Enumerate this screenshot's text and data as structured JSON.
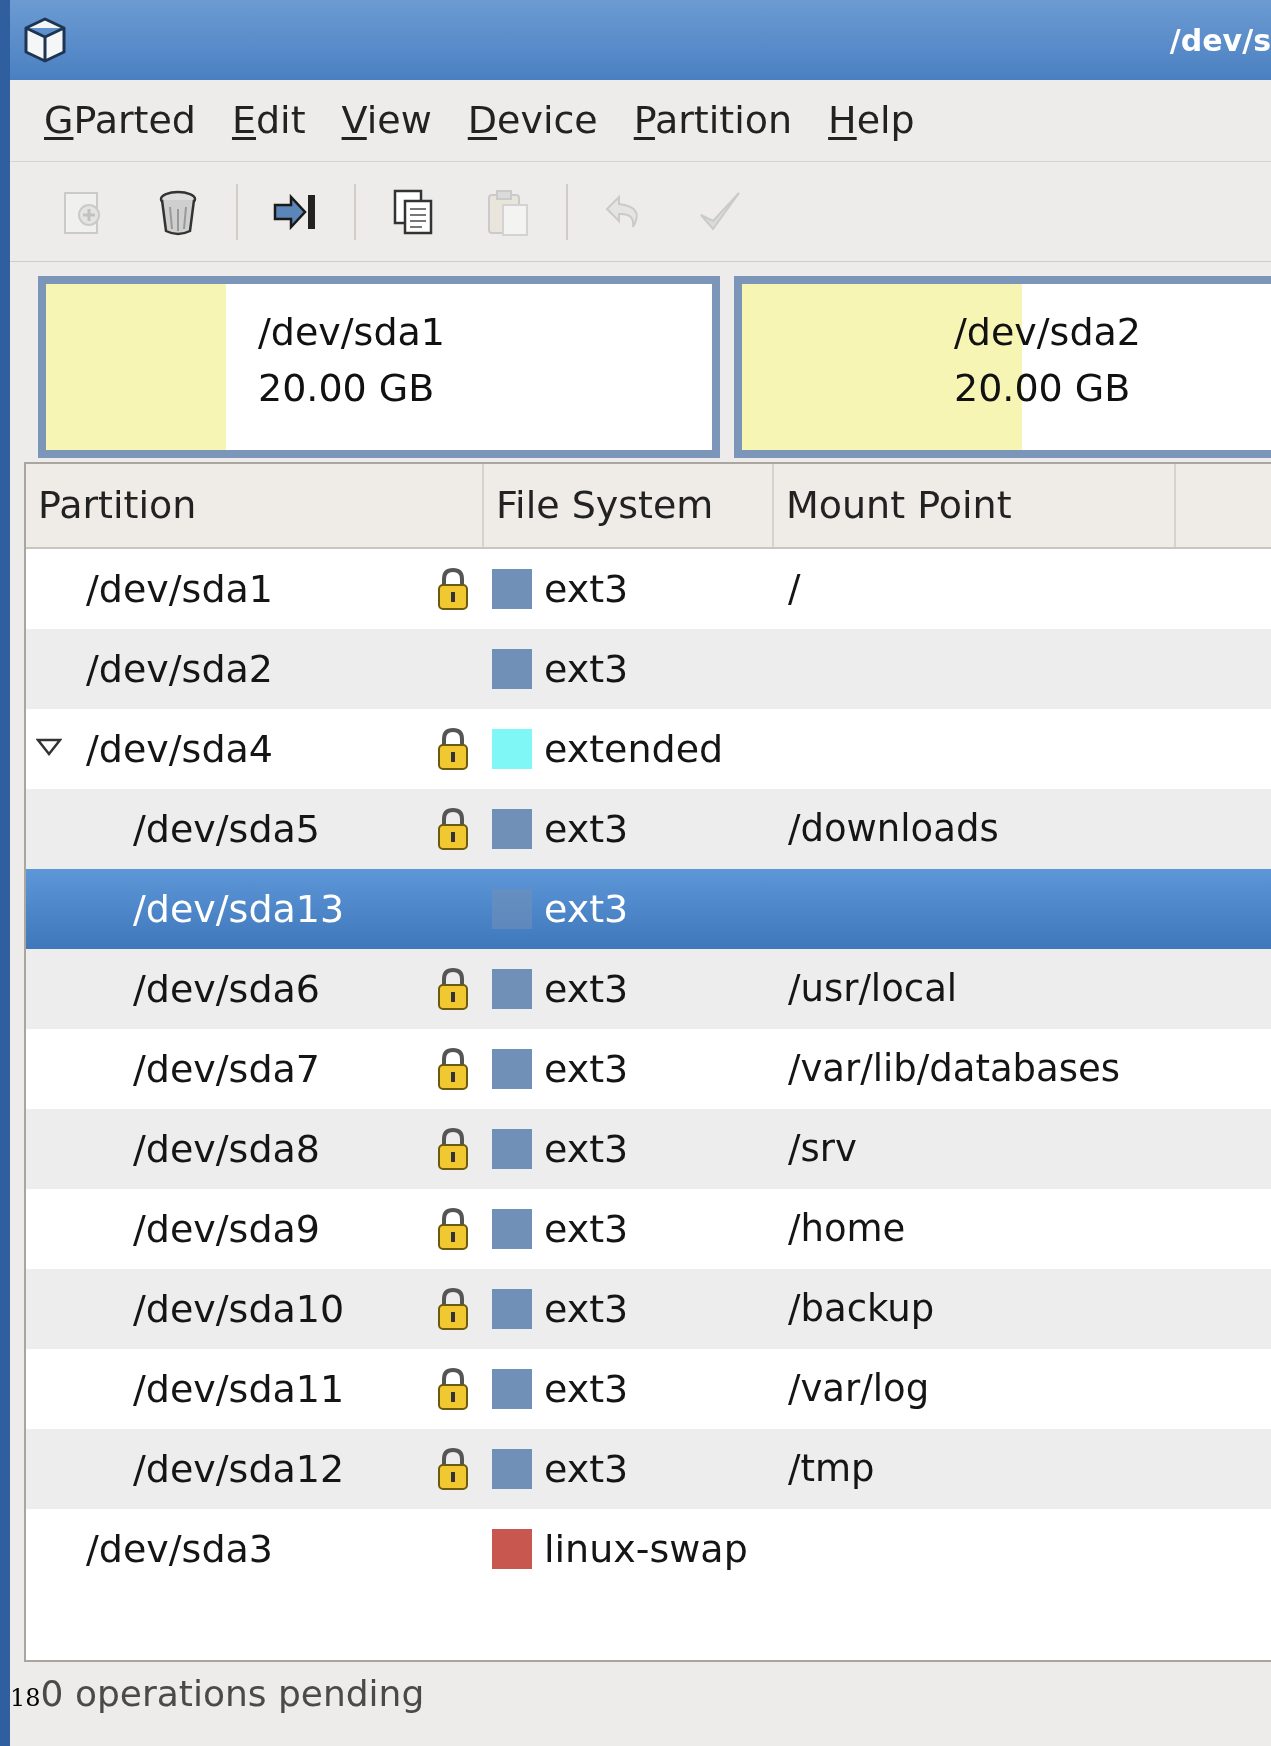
{
  "window": {
    "title": "/dev/s"
  },
  "menu": [
    "GParted",
    "Edit",
    "View",
    "Device",
    "Partition",
    "Help"
  ],
  "toolbar": [
    {
      "kind": "new",
      "disabled": true
    },
    {
      "kind": "delete",
      "disabled": false
    },
    {
      "kind": "separator"
    },
    {
      "kind": "resize",
      "disabled": false
    },
    {
      "kind": "separator"
    },
    {
      "kind": "copy",
      "disabled": false
    },
    {
      "kind": "paste",
      "disabled": true
    },
    {
      "kind": "separator"
    },
    {
      "kind": "undo",
      "disabled": true
    },
    {
      "kind": "apply",
      "disabled": true
    }
  ],
  "disk_graph": [
    {
      "name": "/dev/sda1",
      "size": "20.00 GB",
      "level": 0.27
    },
    {
      "name": "/dev/sda2",
      "size": "20.00 GB"
    }
  ],
  "table": {
    "columns": [
      "Partition",
      "File System",
      "Mount Point"
    ],
    "rows": [
      {
        "partition": "/dev/sda1",
        "locked": true,
        "filesystem": "ext3",
        "color": "#7090b8",
        "mount_point": "/",
        "selected": false
      },
      {
        "partition": "/dev/sda2",
        "locked": false,
        "filesystem": "ext3",
        "color": "#7090b8",
        "selected": false
      },
      {
        "partition": "/dev/sda4",
        "locked": true,
        "filesystem": "extended",
        "color": "#7ff7f7",
        "selected": false,
        "expanded": true,
        "children": [
          {
            "partition": "/dev/sda5",
            "locked": true,
            "filesystem": "ext3",
            "color": "#7090b8",
            "mount_point": "/downloads",
            "selected": false
          },
          {
            "partition": "/dev/sda13",
            "locked": false,
            "filesystem": "ext3",
            "color": "#7090b8",
            "selected": true
          },
          {
            "partition": "/dev/sda6",
            "locked": true,
            "filesystem": "ext3",
            "color": "#7090b8",
            "mount_point": "/usr/local",
            "selected": false
          },
          {
            "partition": "/dev/sda7",
            "locked": true,
            "filesystem": "ext3",
            "color": "#7090b8",
            "mount_point": "/var/lib/databases",
            "selected": false
          },
          {
            "partition": "/dev/sda8",
            "locked": true,
            "filesystem": "ext3",
            "color": "#7090b8",
            "mount_point": "/srv",
            "selected": false
          },
          {
            "partition": "/dev/sda9",
            "locked": true,
            "filesystem": "ext3",
            "color": "#7090b8",
            "mount_point": "/home",
            "selected": false
          },
          {
            "partition": "/dev/sda10",
            "locked": true,
            "filesystem": "ext3",
            "color": "#7090b8",
            "mount_point": "/backup",
            "selected": false
          },
          {
            "partition": "/dev/sda11",
            "locked": true,
            "filesystem": "ext3",
            "color": "#7090b8",
            "mount_point": "/var/log",
            "selected": false
          },
          {
            "partition": "/dev/sda12",
            "locked": true,
            "filesystem": "ext3",
            "color": "#7090b8",
            "mount_point": "/tmp",
            "selected": false
          }
        ]
      },
      {
        "partition": "/dev/sda3",
        "locked": false,
        "filesystem": "linux-swap",
        "color": "#c8584f",
        "selected": false
      }
    ]
  },
  "page_number": "18",
  "status_bar": "0 operations pending"
}
